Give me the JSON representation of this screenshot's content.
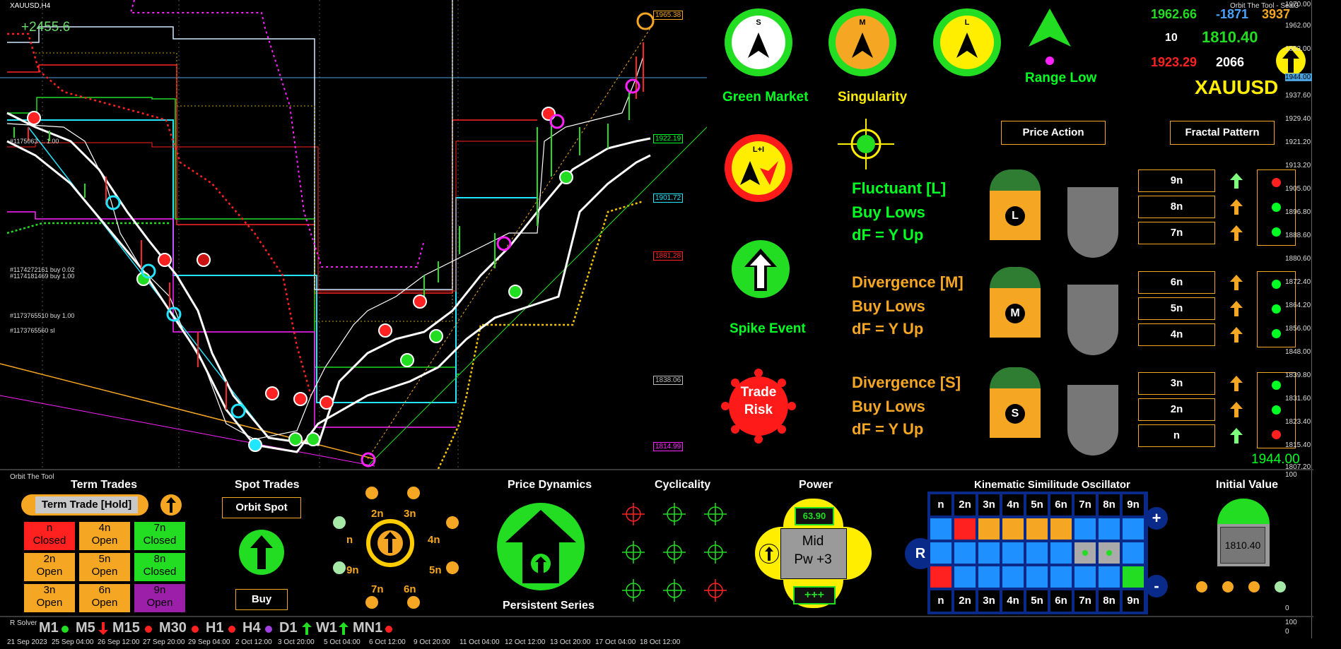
{
  "chart_header": {
    "symbol": "XAUUSD,H4",
    "pnl": "+2455.6",
    "indicator_name": "Orbit The Tool - Seal3"
  },
  "price_axis": [
    "1970.00",
    "1962.00",
    "1953.00",
    "1944.00",
    "1937.60",
    "1929.40",
    "1921.20",
    "1913.20",
    "1905.00",
    "1896.80",
    "1888.60",
    "1880.60",
    "1872.40",
    "1864.20",
    "1856.00",
    "1848.00",
    "1839.80",
    "1831.60",
    "1823.40",
    "1815.40",
    "1807.20"
  ],
  "current_price": "1944.00",
  "price_tags": [
    {
      "label": "1965.38",
      "color": "#f5a623"
    },
    {
      "label": "1922.19",
      "color": "#00ff22"
    },
    {
      "label": "1901.72",
      "color": "#22e5ff"
    },
    {
      "label": "1881.28",
      "color": "#ff2222"
    },
    {
      "label": "1838.06",
      "color": "#bbbbbb"
    },
    {
      "label": "1814.99",
      "color": "#ff22ff"
    }
  ],
  "order_labels": [
    "#1175063 ... 1.00",
    "#1174272161 buy 0.02",
    "#1174181469 buy 1.00",
    "#1173765510 buy 1.00",
    "#1173765560 sl"
  ],
  "time_axis": [
    "21 Sep 2023",
    "25 Sep 04:00",
    "26 Sep 12:00",
    "27 Sep 20:00",
    "29 Sep 04:00",
    "2 Oct 12:00",
    "3 Oct 20:00",
    "5 Oct 04:00",
    "6 Oct 12:00",
    "9 Oct 20:00",
    "11 Oct 04:00",
    "12 Oct 12:00",
    "13 Oct 20:00",
    "17 Oct 04:00",
    "18 Oct 12:00"
  ],
  "stats": {
    "v1": "1962.66",
    "v2": "-1871",
    "v3": "3937",
    "v4": "10",
    "v5": "1810.40",
    "v6": "1923.29",
    "v7": "2066",
    "symbol": "XAUUSD"
  },
  "compass": [
    {
      "letter": "S",
      "caption": "Green Market"
    },
    {
      "letter": "M",
      "caption": "Singularity"
    },
    {
      "letter": "L",
      "caption": ""
    }
  ],
  "range_low": "Range Low",
  "lplus": "L+I",
  "spike_event": "Spike Event",
  "trade_risk": [
    "Trade",
    "Risk"
  ],
  "tabs": {
    "price_action": "Price Action",
    "fractal_pattern": "Fractal Pattern"
  },
  "sections": [
    {
      "title": "Fluctuant [L]",
      "line2": "Buy Lows",
      "line3": "dF = Y Up",
      "letter": "L",
      "rows": [
        "9n",
        "8n",
        "7n"
      ],
      "arrows": [
        "#7dff7d",
        "#f5a623",
        "#f5a623"
      ],
      "dots": [
        "#ff2020",
        "#00ff22",
        "#00ff22"
      ]
    },
    {
      "title": "Divergence [M]",
      "line2": "Buy Lows",
      "line3": "dF = Y Up",
      "letter": "M",
      "rows": [
        "6n",
        "5n",
        "4n"
      ],
      "arrows": [
        "#f5a623",
        "#f5a623",
        "#f5a623"
      ],
      "dots": [
        "#00ff22",
        "#00ff22",
        "#00ff22"
      ]
    },
    {
      "title": "Divergence [S]",
      "line2": "Buy Lows",
      "line3": "dF = Y Up",
      "letter": "S",
      "rows": [
        "3n",
        "2n",
        "n"
      ],
      "arrows": [
        "#f5a623",
        "#f5a623",
        "#7dff7d"
      ],
      "dots": [
        "#00ff22",
        "#00ff22",
        "#ff2020"
      ]
    }
  ],
  "price_right": "1944.00",
  "lower_panel": {
    "name": "Orbit The Tool",
    "term_trades": {
      "title": "Term Trades",
      "button": "Term Trade [Hold]",
      "cells": [
        {
          "n": "n",
          "s": "Closed",
          "bg": "#ff2020"
        },
        {
          "n": "4n",
          "s": "Open",
          "bg": "#f5a623"
        },
        {
          "n": "7n",
          "s": "Closed",
          "bg": "#22dd22"
        },
        {
          "n": "2n",
          "s": "Open",
          "bg": "#f5a623"
        },
        {
          "n": "5n",
          "s": "Open",
          "bg": "#f5a623"
        },
        {
          "n": "8n",
          "s": "Closed",
          "bg": "#22dd22"
        },
        {
          "n": "3n",
          "s": "Open",
          "bg": "#f5a623"
        },
        {
          "n": "6n",
          "s": "Open",
          "bg": "#f5a623"
        },
        {
          "n": "9n",
          "s": "Open",
          "bg": "#9b1fa8"
        }
      ]
    },
    "spot_trades": {
      "title": "Spot Trades",
      "button": "Orbit Spot",
      "action": "Buy"
    },
    "dial": {
      "labels": [
        "2n",
        "3n",
        "n",
        "4n",
        "9n",
        "5n",
        "7n",
        "6n"
      ]
    },
    "price_dynamics": {
      "title": "Price Dynamics",
      "caption": "Persistent Series"
    },
    "cyclicality": {
      "title": "Cyclicality"
    },
    "power": {
      "title": "Power",
      "value": "63.90",
      "label1": "Mid",
      "label2": "Pw +3",
      "plus": "+++"
    },
    "oscillator": {
      "title": "Kinematic Similitude Oscillator",
      "headers": [
        "n",
        "2n",
        "3n",
        "4n",
        "5n",
        "6n",
        "7n",
        "8n",
        "9n"
      ],
      "r": "R",
      "plus": "+",
      "minus": "-",
      "rows": [
        [
          "#1e90ff",
          "#ff2020",
          "#f5a623",
          "#f5a623",
          "#f5a623",
          "#f5a623",
          "#1e90ff",
          "#1e90ff",
          "#1e90ff"
        ],
        [
          "#1e90ff",
          "#1e90ff",
          "#1e90ff",
          "#1e90ff",
          "#1e90ff",
          "#1e90ff",
          "#aaaaaa",
          "#aaaaaa",
          "#1e90ff"
        ],
        [
          "#ff2020",
          "#1e90ff",
          "#1e90ff",
          "#1e90ff",
          "#1e90ff",
          "#1e90ff",
          "#1e90ff",
          "#1e90ff",
          "#22dd22"
        ]
      ]
    },
    "initial_value": {
      "title": "Initial Value",
      "value": "1810.40"
    },
    "lower_axis": [
      "100",
      "0"
    ]
  },
  "solver": {
    "name": "R Solver",
    "timeframes": [
      {
        "tf": "M1",
        "mark": "dot",
        "color": "#22dd22"
      },
      {
        "tf": "M5",
        "mark": "down",
        "color": "#ff2020"
      },
      {
        "tf": "M15",
        "mark": "dot",
        "color": "#ff2020"
      },
      {
        "tf": "M30",
        "mark": "dot",
        "color": "#ff2020"
      },
      {
        "tf": "H1",
        "mark": "dot",
        "color": "#ff2020"
      },
      {
        "tf": "H4",
        "mark": "dot",
        "color": "#a040e0"
      },
      {
        "tf": "D1",
        "mark": "up",
        "color": "#22dd22"
      },
      {
        "tf": "W1",
        "mark": "up",
        "color": "#22dd22"
      },
      {
        "tf": "MN1",
        "mark": "dot",
        "color": "#ff2020"
      }
    ],
    "axis": [
      "100",
      "0"
    ]
  }
}
